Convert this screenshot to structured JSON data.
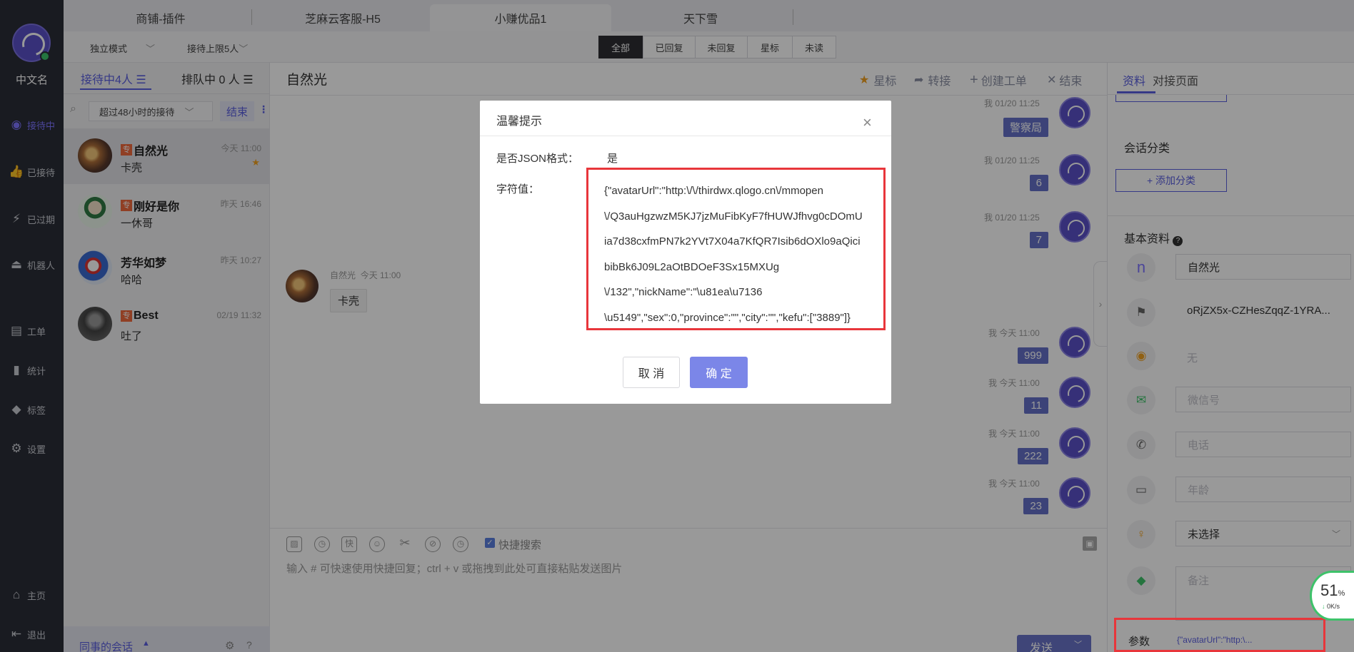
{
  "rail": {
    "user_name": "中文名",
    "items": [
      {
        "label": "接待中",
        "icon": "chat-bubbles-icon"
      },
      {
        "label": "已接待",
        "icon": "thumb-up-icon"
      },
      {
        "label": "已过期",
        "icon": "expired-icon"
      },
      {
        "label": "机器人",
        "icon": "robot-icon"
      },
      {
        "label": "工单",
        "icon": "ticket-icon"
      },
      {
        "label": "统计",
        "icon": "bar-chart-icon"
      },
      {
        "label": "标签",
        "icon": "tag-icon"
      },
      {
        "label": "设置",
        "icon": "gear-icon"
      }
    ],
    "bottom": [
      {
        "label": "主页",
        "icon": "home-icon"
      },
      {
        "label": "退出",
        "icon": "logout-icon"
      }
    ]
  },
  "top_tabs": [
    "商铺-插件",
    "芝麻云客服-H5",
    "小赚优品1",
    "天下雪"
  ],
  "subbar": {
    "mode": "独立模式",
    "limit": "接待上限5人",
    "filters": [
      "全部",
      "已回复",
      "未回复",
      "星标",
      "未读"
    ]
  },
  "sessions": {
    "tab_active": "接待中4人",
    "tab_queue": "排队中 0 人",
    "filter_label": "超过48小时的接待",
    "end_label": "结束",
    "items": [
      {
        "name": "自然光",
        "msg": "卡壳",
        "time": "今天 11:00",
        "vip": "专"
      },
      {
        "name": "刚好是你",
        "msg": "一休哥",
        "time": "昨天 16:46",
        "vip": "专"
      },
      {
        "name": "芳华如梦",
        "msg": "哈哈",
        "time": "昨天 10:27",
        "vip": ""
      },
      {
        "name": "Best",
        "msg": "吐了",
        "time": "02/19 11:32",
        "vip": "专"
      }
    ],
    "colleague": "同事的会话"
  },
  "chat": {
    "title": "自然光",
    "actions": [
      "星标",
      "转接",
      "创建工单",
      "结束"
    ],
    "messages": [
      {
        "meta": "我  01/20 11:25",
        "text": "警察局"
      },
      {
        "meta": "我  01/20 11:25",
        "text": "6"
      },
      {
        "meta": "我  01/20 11:25",
        "text": "7"
      },
      {
        "meta": "我  今天 11:00",
        "text": "999"
      },
      {
        "meta": "我  今天 11:00",
        "text": "11"
      },
      {
        "meta": "我  今天 11:00",
        "text": "222"
      },
      {
        "meta": "我  今天 11:00",
        "text": "23"
      }
    ],
    "incoming": {
      "name": "自然光",
      "time": "今天 11:00",
      "text": "卡壳"
    },
    "quick_search": "快捷搜索",
    "input_placeholder": "输入 # 可快速使用快捷回复；ctrl + v 或拖拽到此处可直接粘贴发送图片",
    "send_label": "发送"
  },
  "right_panel": {
    "tabs": [
      "资料",
      "对接页面"
    ],
    "session_class": "会话分类",
    "add_class": "+ 添加分类",
    "basic_info": "基本资料",
    "fields": {
      "name": "自然光",
      "openid": "oRjZX5x-CZHesZqqZ-1YRA...",
      "location": "无",
      "wechat": "微信号",
      "phone": "电话",
      "age": "年龄",
      "gender": "未选择",
      "note": "备注"
    },
    "param_label": "参数",
    "param_value": "{\"avatarUrl\":\"http:\\..."
  },
  "speed_widget": {
    "percent": "51",
    "rate": "0K/s"
  },
  "dialog": {
    "title": "温馨提示",
    "json_label": "是否JSON格式：",
    "json_value": "是",
    "string_label": "字符值：",
    "string_lines": [
      "{\"avatarUrl\":\"http:\\/\\/thirdwx.qlogo.cn\\/mmopen",
      "\\/Q3auHgzwzM5KJ7jzMuFibKyF7fHUWJfhvg0cDOmU",
      "ia7d38cxfmPN7k2YVt7X04a7KfQR7Isib6dOXlo9aQici",
      "bibBk6J09L2aOtBDOeF3Sx15MXUg",
      "\\/132\",\"nickName\":\"\\u81ea\\u7136",
      "\\u5149\",\"sex\":0,\"province\":\"\",\"city\":\"\",\"kefu\":[\"3889\"]}"
    ],
    "cancel": "取 消",
    "confirm": "确 定"
  }
}
